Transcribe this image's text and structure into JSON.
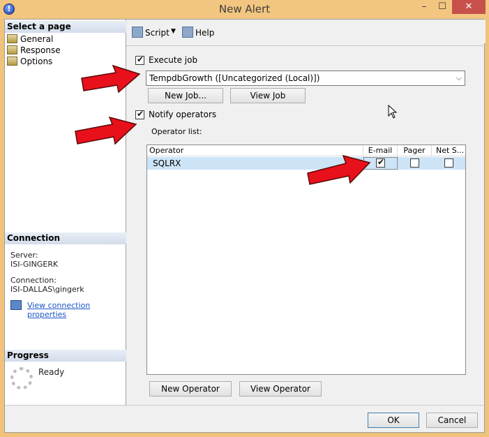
{
  "window": {
    "title": "New Alert"
  },
  "left_pane": {
    "select_page_header": "Select a page",
    "pages": [
      {
        "label": "General"
      },
      {
        "label": "Response"
      },
      {
        "label": "Options"
      }
    ],
    "connection_header": "Connection",
    "server_label": "Server:",
    "server_value": "ISI-GINGERK",
    "connection_label": "Connection:",
    "connection_value": "ISI-DALLAS\\gingerk",
    "view_connection_link": "View connection properties",
    "progress_header": "Progress",
    "progress_status": "Ready"
  },
  "toolbar": {
    "script_label": "Script",
    "help_label": "Help"
  },
  "response": {
    "execute_job_label": "Execute job",
    "execute_job_checked": true,
    "job_selected": "TempdbGrowth ([Uncategorized (Local)])",
    "new_job_button": "New Job...",
    "view_job_button": "View Job",
    "notify_operators_label": "Notify operators",
    "notify_operators_checked": true,
    "operator_list_label": "Operator list:",
    "columns": [
      "Operator",
      "E-mail",
      "Pager",
      "Net S..."
    ],
    "operators": [
      {
        "name": "SQLRX",
        "email": true,
        "pager": false,
        "net_send": false
      }
    ],
    "new_operator_button": "New Operator",
    "view_operator_button": "View Operator"
  },
  "footer": {
    "ok_button": "OK",
    "cancel_button": "Cancel"
  },
  "colors": {
    "titlebar": "#f2c680",
    "close_button": "#c7504b",
    "annotation_arrow": "#e8101a",
    "selected_row": "#cde4f7"
  }
}
